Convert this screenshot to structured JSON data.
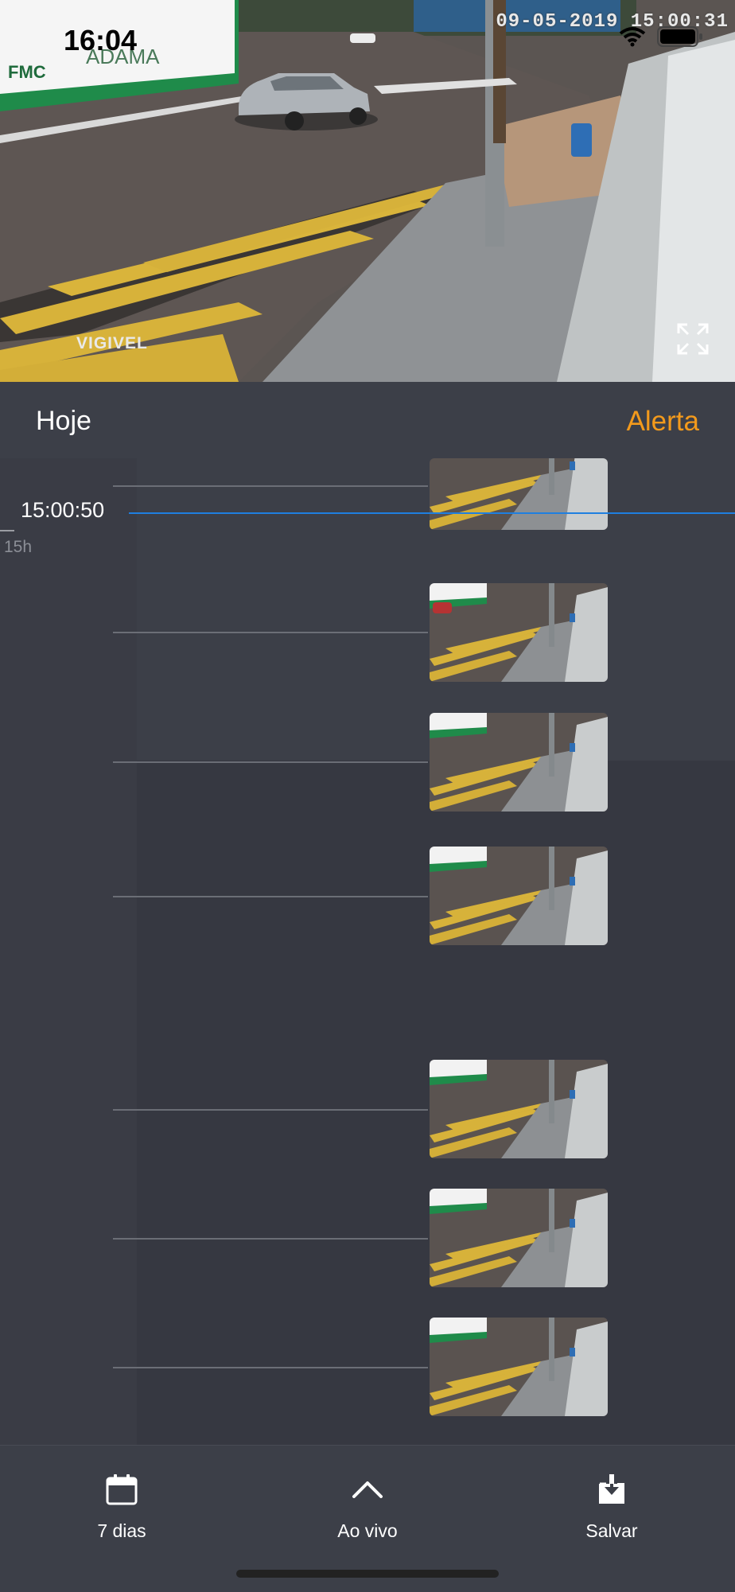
{
  "status_bar": {
    "time": "16:04"
  },
  "camera": {
    "timestamp": "09-05-2019 15:00:31",
    "watermark": "VIGIVEL",
    "banner_text": "ADAMA",
    "banner_small": "FMC"
  },
  "header": {
    "title": "Hoje",
    "alert_label": "Alerta"
  },
  "timeline": {
    "cursor_time": "15:00:50",
    "hour_label": "15h",
    "events": [
      {
        "id": 1
      },
      {
        "id": 2
      },
      {
        "id": 3
      },
      {
        "id": 4
      },
      {
        "id": 5
      },
      {
        "id": 6
      },
      {
        "id": 7
      }
    ]
  },
  "bottom_bar": {
    "days_label": "7 dias",
    "live_label": "Ao vivo",
    "save_label": "Salvar"
  },
  "colors": {
    "accent": "#f39a1c",
    "cursor": "#1f7fe0",
    "background": "#3c3f48"
  },
  "icons": [
    "fullscreen-icon",
    "calendar-icon",
    "chevron-up-icon",
    "download-icon",
    "wifi-icon",
    "battery-icon"
  ]
}
